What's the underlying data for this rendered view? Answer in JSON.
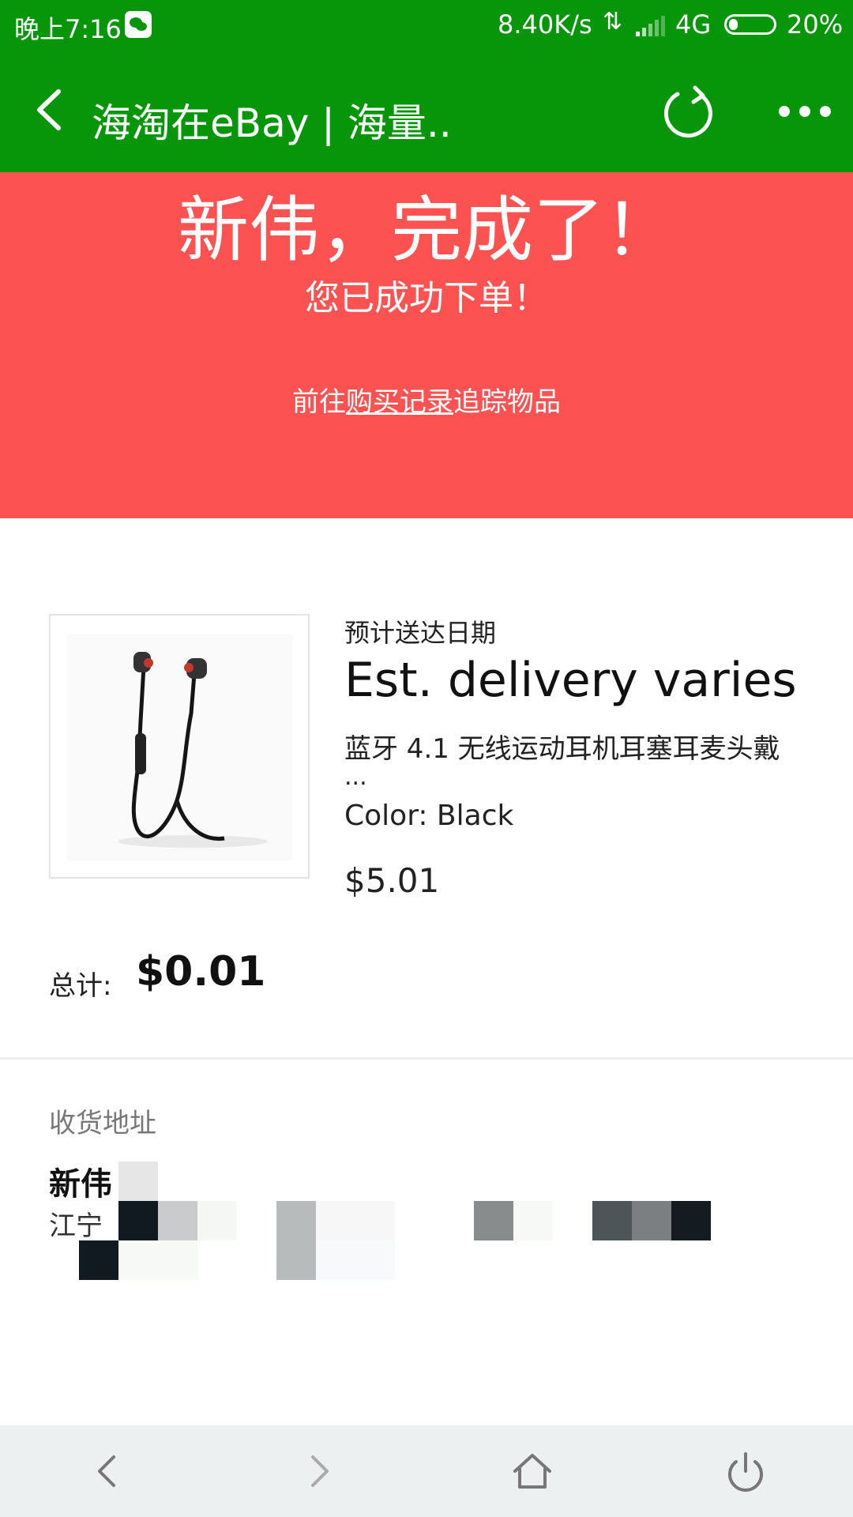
{
  "status_bar": {
    "time": "晚上7:16",
    "app_icon": "wechat-icon",
    "net_speed": "8.40K/s",
    "net_type": "4G",
    "battery_percent": "20%",
    "battery_level": 0.2
  },
  "nav": {
    "title": "海淘在eBay | 海量..",
    "back_icon": "chevron-left-icon",
    "refresh_icon": "refresh-icon",
    "more_icon": "more-dots-icon"
  },
  "banner": {
    "headline": "新伟，完成了！",
    "subtitle": "您已成功下单！",
    "link_prefix": "前往",
    "link_text": "购买记录",
    "link_suffix": "追踪物品",
    "bg_color": "#fc5352"
  },
  "order": {
    "eta_label": "预计送达日期",
    "eta_value": "Est. delivery varies",
    "product_title": "蓝牙 4.1 无线运动耳机耳塞耳麦头戴",
    "product_title_ellipsis": "...",
    "color": "Color: Black",
    "price": "$5.01",
    "total_label": "总计:",
    "total_value": "$0.01"
  },
  "shipping": {
    "label": "收货地址",
    "name": "新伟",
    "address_line": "江宁"
  },
  "bottom_bar": {
    "back_icon": "back-arrow-icon",
    "forward_icon": "forward-arrow-icon",
    "home_icon": "home-icon",
    "power_icon": "power-icon"
  },
  "colors": {
    "wechat_green": "#07960a",
    "banner_red": "#fc5352"
  }
}
